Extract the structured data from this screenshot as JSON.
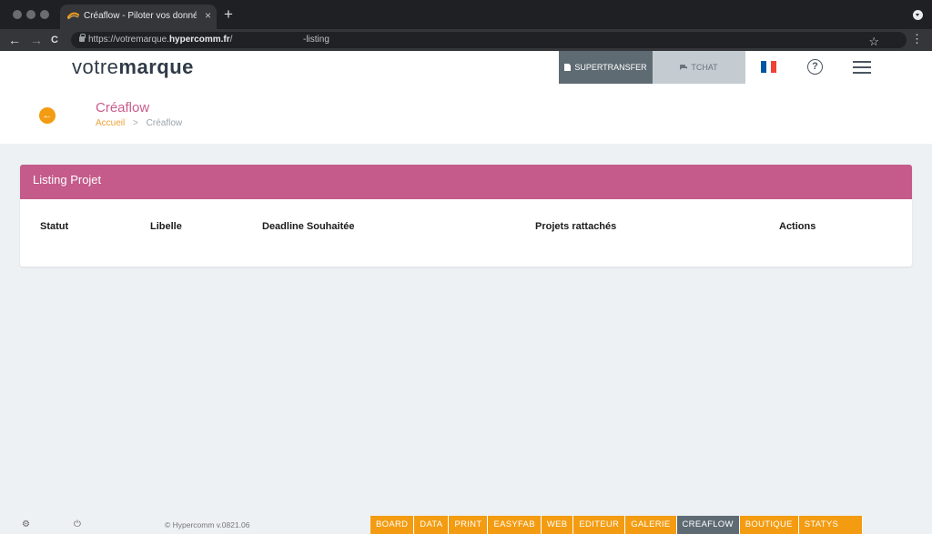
{
  "browser": {
    "tab_title": "Créaflow - Piloter vos données",
    "tab_close": "×",
    "new_tab": "+",
    "url_prefix": "https://votremarque.",
    "url_host": "hypercomm.fr",
    "url_path": "/",
    "url_suffix": "-listing",
    "back": "←",
    "forward": "→",
    "reload": "C",
    "star": "☆",
    "menu": "⋮"
  },
  "header": {
    "brand_light": "votre",
    "brand_bold": "marque",
    "supertransfer_label": "SUPERTRANSFER",
    "tchat_label": "TCHAT",
    "help_symbol": "?",
    "flag_colors": [
      "#0055a4",
      "#ffffff",
      "#ef4135"
    ]
  },
  "page": {
    "back_arrow": "←",
    "title": "Créaflow",
    "breadcrumb_home": "Accueil",
    "breadcrumb_sep": ">",
    "breadcrumb_current": "Créaflow"
  },
  "card": {
    "title": "Listing Projet",
    "columns": [
      "Statut",
      "Libelle",
      "Deadline Souhaitée",
      "Projets rattachés",
      "Actions"
    ]
  },
  "footer": {
    "settings_icon": "⚙",
    "power_icon": "⏻",
    "copyright": "© Hypercomm v.0821.06",
    "modules": [
      "BOARD",
      "DATA",
      "PRINT",
      "EASYFAB",
      "WEB",
      "EDITEUR",
      "GALERIE",
      "CREAFLOW",
      "BOUTIQUE",
      "STATYS"
    ],
    "active_module": "CREAFLOW"
  },
  "colors": {
    "accent_pink": "#c45b8a",
    "accent_orange": "#f39c12",
    "dark_slate": "#5f6b73"
  }
}
